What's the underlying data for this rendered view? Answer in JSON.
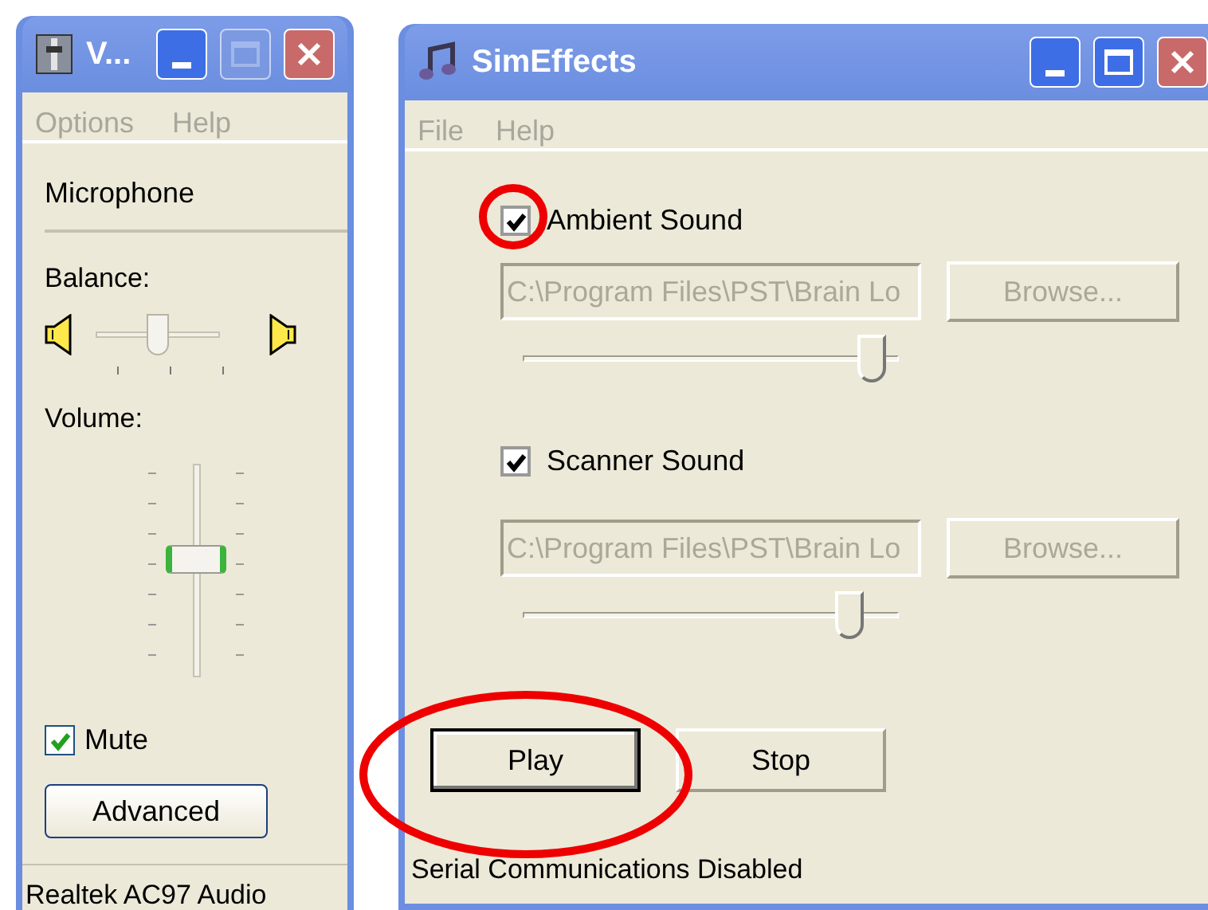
{
  "volume_window": {
    "title": "V...",
    "maximize_enabled": false,
    "menu": [
      "Options",
      "Help"
    ],
    "device": "Microphone",
    "balance": {
      "label": "Balance:",
      "level": 0.5
    },
    "volume": {
      "label": "Volume:",
      "level": 0.55
    },
    "mute": {
      "label": "Mute",
      "checked": true
    },
    "advanced_button": "Advanced",
    "status_bar": "Realtek AC97 Audio"
  },
  "simeffects_window": {
    "title": "SimEffects",
    "maximize_enabled": true,
    "menu": [
      "File",
      "Help"
    ],
    "sounds": [
      {
        "label": "Ambient Sound",
        "checked": true,
        "path": "C:\\Program Files\\PST\\Brain Lo",
        "browse": "Browse...",
        "disabled": true,
        "level": 0.93
      },
      {
        "label": "Scanner Sound",
        "checked": true,
        "path": "C:\\Program Files\\PST\\Brain Lo",
        "browse": "Browse...",
        "disabled": true,
        "level": 0.87
      }
    ],
    "buttons": [
      {
        "label": "Play",
        "default": true
      },
      {
        "label": "Stop",
        "default": false
      }
    ],
    "status_bar": "Serial Communications Disabled"
  }
}
